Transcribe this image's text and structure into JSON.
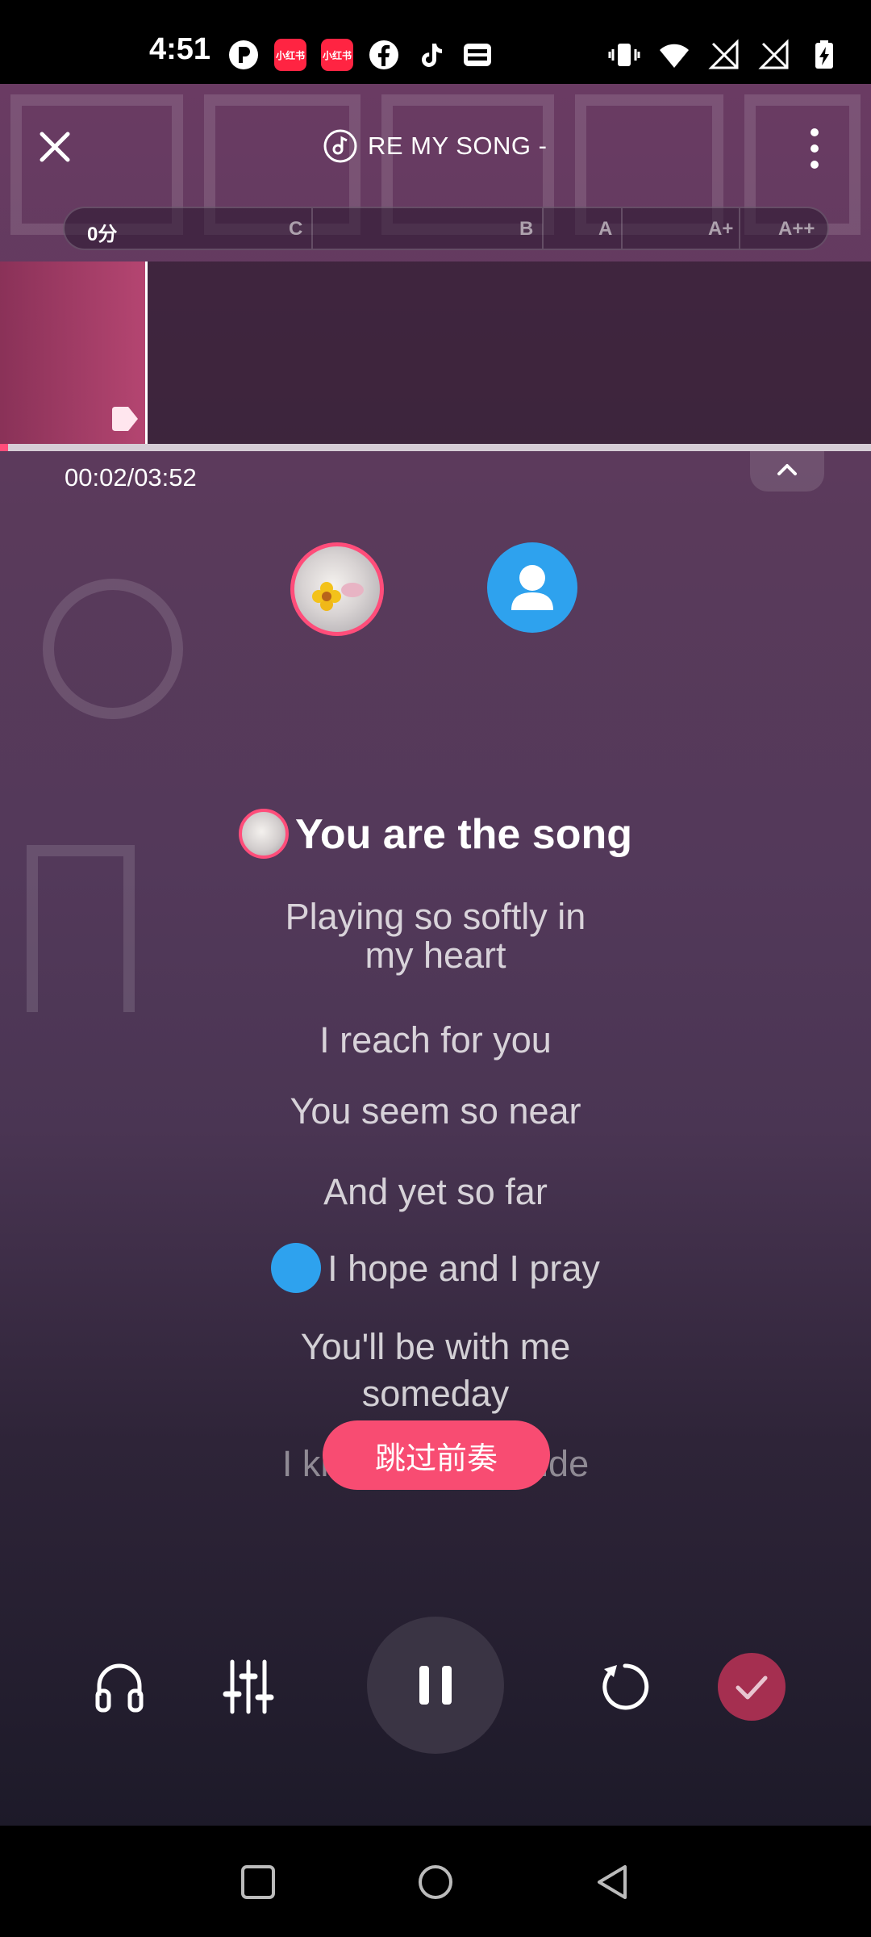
{
  "status_bar": {
    "time": "4:51",
    "left_icons": [
      "p-icon",
      "xiaohongshu-icon",
      "xiaohongshu-icon",
      "facebook-icon",
      "tiktok-icon",
      "wallet-icon"
    ],
    "xiaohongshu_label": "小红书",
    "right_icons": [
      "vibrate-icon",
      "wifi-icon",
      "no-signal-icon",
      "no-signal-icon",
      "battery-charging-icon"
    ]
  },
  "header": {
    "title": "RE MY SONG  -"
  },
  "score_bar": {
    "current_score": "0分",
    "grades": [
      "C",
      "B",
      "A",
      "A+",
      "A++"
    ]
  },
  "player": {
    "time": "00:02/03:52",
    "progress": 0.009
  },
  "lyrics": [
    {
      "text": "You are the song",
      "current": true,
      "singer": "a1"
    },
    {
      "text": "Playing so softly in my heart",
      "current": false
    },
    {
      "text": "I reach for you",
      "current": false
    },
    {
      "text": "You seem so near",
      "current": false
    },
    {
      "text": "And yet so far",
      "current": false
    },
    {
      "text": "I hope and I pray",
      "current": false,
      "singer": "a2"
    },
    {
      "text": "You'll be with me someday",
      "current": false
    },
    {
      "text": "I know down inside",
      "current": false
    }
  ],
  "skip_button": "跳过前奏",
  "controls": [
    "headphones-icon",
    "mixer-icon",
    "pause-icon",
    "restart-icon",
    "check-icon"
  ],
  "nav": [
    "recents-icon",
    "home-icon",
    "back-icon"
  ]
}
